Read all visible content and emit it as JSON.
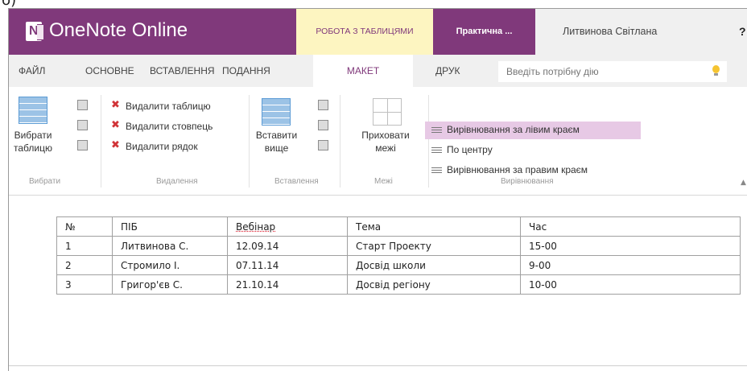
{
  "corner_label": "б)",
  "app_title": "OneNote Online",
  "context_tab": "РОБОТА З ТАБЛИЦЯМИ",
  "document_tab": "Практична ...",
  "user_name": "Литвинова Світлана",
  "help_label": "?",
  "ribbon_tabs": [
    {
      "label": "ФАЙЛ"
    },
    {
      "label": "ОСНОВНЕ"
    },
    {
      "label": "ВСТАВЛЕННЯ"
    },
    {
      "label": "ПОДАННЯ"
    },
    {
      "label": "МАКЕТ"
    },
    {
      "label": "ДРУК"
    }
  ],
  "active_tab": "МАКЕТ",
  "tell_me_placeholder": "Введіть потрібну дію",
  "groups": {
    "select": {
      "button_line1": "Вибрати",
      "button_line2": "таблицю",
      "label": "Вибрати"
    },
    "delete": {
      "items": [
        "Видалити таблицю",
        "Видалити стовпець",
        "Видалити рядок"
      ],
      "label": "Видалення"
    },
    "insert": {
      "button_line1": "Вставити",
      "button_line2": "вище",
      "label": "Вставлення"
    },
    "borders": {
      "button_line1": "Приховати",
      "button_line2": "межі",
      "label": "Межі"
    },
    "alignment": {
      "items": [
        "Вирівнювання за лівим краєм",
        "По центру",
        "Вирівнювання за правим краєм"
      ],
      "label": "Вирівнювання"
    }
  },
  "table": {
    "headers": [
      "№",
      "ПІБ",
      "Вебінар",
      "Тема",
      "Час"
    ],
    "rows": [
      [
        "1",
        "Литвинова С.",
        "12.09.14",
        "Старт Проекту",
        "15-00"
      ],
      [
        "2",
        "Стромило І.",
        "07.11.14",
        "Досвід школи",
        "9-00"
      ],
      [
        "3",
        "Григор'єв С.",
        "21.10.14",
        "Досвід регіону",
        "10-00"
      ]
    ]
  },
  "colors": {
    "brand_purple": "#80397b",
    "context_yellow": "#fdf5c1",
    "highlight_pink": "#e7c9e5"
  }
}
